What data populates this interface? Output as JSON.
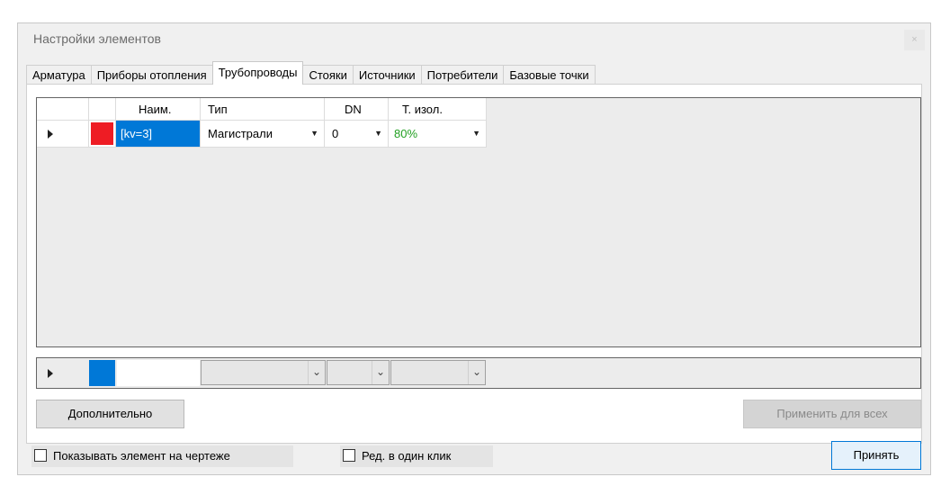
{
  "window": {
    "title": "Настройки элементов",
    "close_label": "×"
  },
  "tabs": [
    {
      "label": "Арматура"
    },
    {
      "label": "Приборы отопления"
    },
    {
      "label": "Трубопроводы"
    },
    {
      "label": "Стояки"
    },
    {
      "label": "Источники"
    },
    {
      "label": "Потребители"
    },
    {
      "label": "Базовые точки"
    }
  ],
  "active_tab": "Трубопроводы",
  "table": {
    "headers": [
      "",
      "",
      "Наим.",
      "Тип",
      "DN",
      "Т. изол."
    ],
    "rows": [
      {
        "color": "#ee1c24",
        "name": "[kv=3]",
        "type": "Магистрали",
        "dn": "0",
        "insulation": "80%"
      }
    ],
    "insulation_color": "#22a022",
    "selection_color": "#0078d7"
  },
  "new_row": {
    "color": "#0078d7"
  },
  "buttons": {
    "additional": "Дополнительно",
    "apply_all": "Применить для всех",
    "accept": "Принять"
  },
  "checkboxes": {
    "show_on_drawing": {
      "label": "Показывать элемент на чертеже",
      "checked": false
    },
    "one_click_edit": {
      "label": "Ред. в один клик",
      "checked": false
    }
  },
  "icons": {
    "row_pointer": "triangle-right-icon",
    "dropdown": "chevron-down-icon"
  }
}
